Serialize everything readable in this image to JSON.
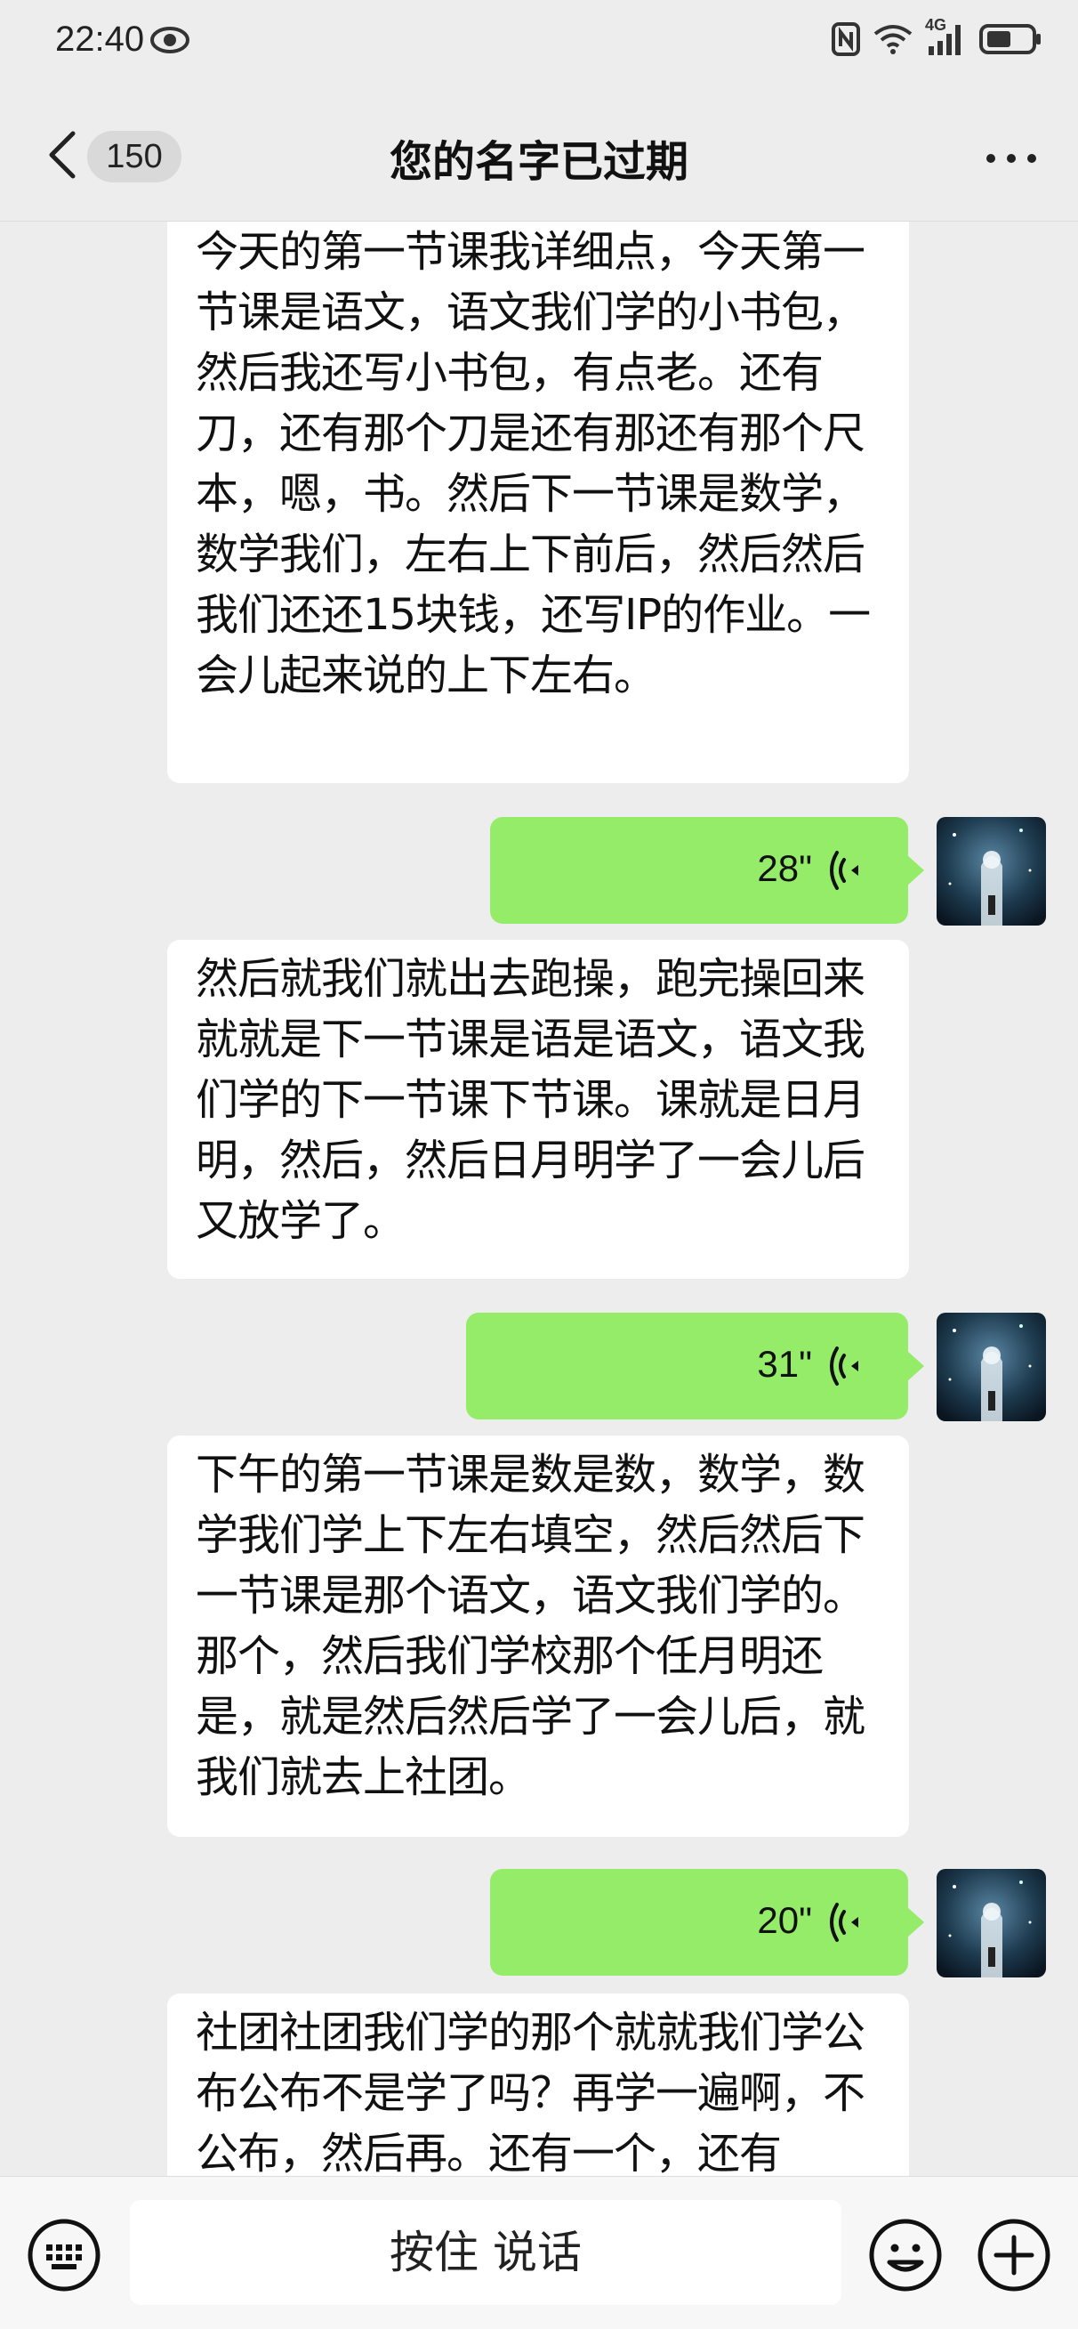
{
  "status_bar": {
    "time": "22:40",
    "network": "4G"
  },
  "header": {
    "unread_count": "150",
    "title": "您的名字已过期"
  },
  "messages": [
    {
      "type": "text",
      "side": "left",
      "text": "今天的第一节课我详细点，今天第一节课是语文，语文我们学的小书包，然后我还写小书包，有点老。还有刀，还有那个刀是还有那还有那个尺本，嗯，书。然后下一节课是数学，数学我们，左右上下前后，然后然后我们还还15块钱，还写IP的作业。一会儿起来说的上下左右。"
    },
    {
      "type": "voice",
      "side": "right",
      "duration": "28\""
    },
    {
      "type": "text",
      "side": "left",
      "text": "然后就我们就出去跑操，跑完操回来就就是下一节课是语是语文，语文我们学的下一节课下节课。课就是日月明，然后，然后日月明学了一会儿后又放学了。"
    },
    {
      "type": "voice",
      "side": "right",
      "duration": "31\""
    },
    {
      "type": "text",
      "side": "left",
      "text": "下午的第一节课是数是数，数学，数学我们学上下左右填空，然后然后下一节课是那个语文，语文我们学的。那个，然后我们学校那个任月明还是，就是然后然后学了一会儿后，就我们就去上社团。"
    },
    {
      "type": "voice",
      "side": "right",
      "duration": "20\""
    },
    {
      "type": "text",
      "side": "left",
      "text": "社团社团我们学的那个就就我们学公布公布不是学了吗？再学一遍啊，不公布，然后再。还有一个，还有"
    }
  ],
  "input_bar": {
    "hold_to_talk": "按住 说话"
  },
  "colors": {
    "background": "#ededed",
    "voice_bubble": "#95ec69",
    "text_bubble": "#ffffff"
  },
  "icons": [
    "eye-icon",
    "nfc-icon",
    "wifi-icon",
    "signal-icon",
    "battery-icon",
    "back-chevron-icon",
    "more-dots-icon",
    "voice-wave-icon",
    "keyboard-icon",
    "emoji-icon",
    "plus-icon"
  ]
}
